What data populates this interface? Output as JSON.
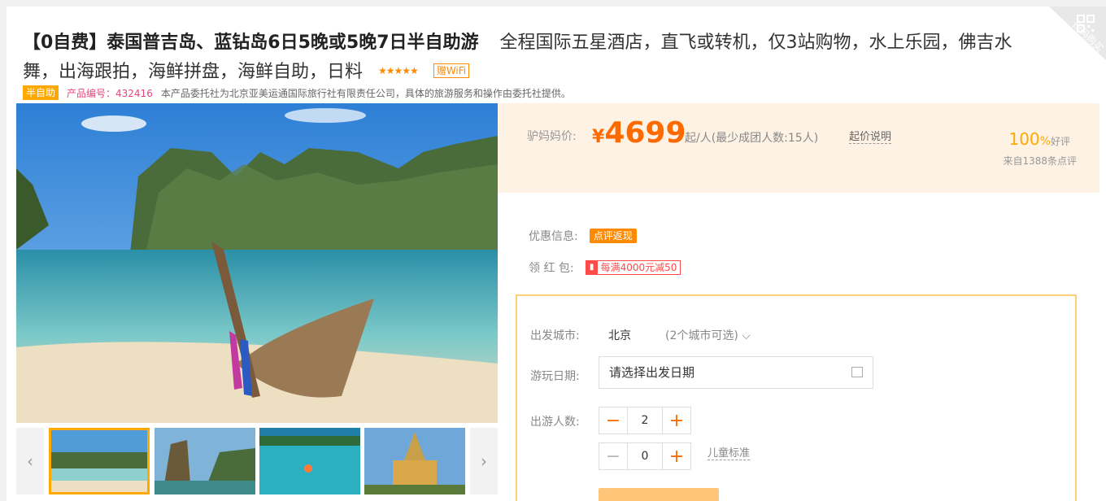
{
  "product": {
    "title_bold": "【0自费】泰国普吉岛、蓝钻岛6日5晚或5晚7日半自助游",
    "title_sub": "全程国际五星酒店，直飞或转机，仅3站购物，水上乐园，佛吉水舞，出海跟拍，海鲜拼盘，海鲜自助，日料",
    "stars": "★★★★★",
    "wifi_tag": "赠WiFi",
    "type_tag": "半自助",
    "product_no": "产品编号：432416",
    "agency_note": "本产品委托社为北京亚美运通国际旅行社有限责任公司，具体的旅游服务和操作由委托社提供。",
    "scan_label": "扫码购买"
  },
  "price": {
    "label": "驴妈妈价:",
    "currency": "¥",
    "amount": "4699",
    "unit": "起/人(最少成团人数:15人)",
    "info_link": "起价说明",
    "rating": "100",
    "rating_pct": "%",
    "rating_word": "好评",
    "reviews": "来自1388条点评"
  },
  "promo": {
    "discount_label": "优惠信息:",
    "discount_tag": "点评返现",
    "redpacket_label": "领 红 包:",
    "redpacket_tag": "每满4000元减50"
  },
  "booking": {
    "city_label": "出发城市:",
    "city_value": "北京",
    "city_more": "(2个城市可选)",
    "date_label": "游玩日期:",
    "date_placeholder": "请选择出发日期",
    "people_label": "出游人数:",
    "adults": "2",
    "children": "0",
    "child_std": "儿童标准"
  },
  "icons": {
    "prev": "‹",
    "next": "›",
    "minus": "−",
    "plus": "+",
    "dropdown": "⌵",
    "redpacket": "▮"
  },
  "colors": {
    "accent": "#ff6a00",
    "tag_orange": "#ffa800",
    "border_gold": "#ffd07a",
    "price_bg": "#fdf2e4"
  }
}
